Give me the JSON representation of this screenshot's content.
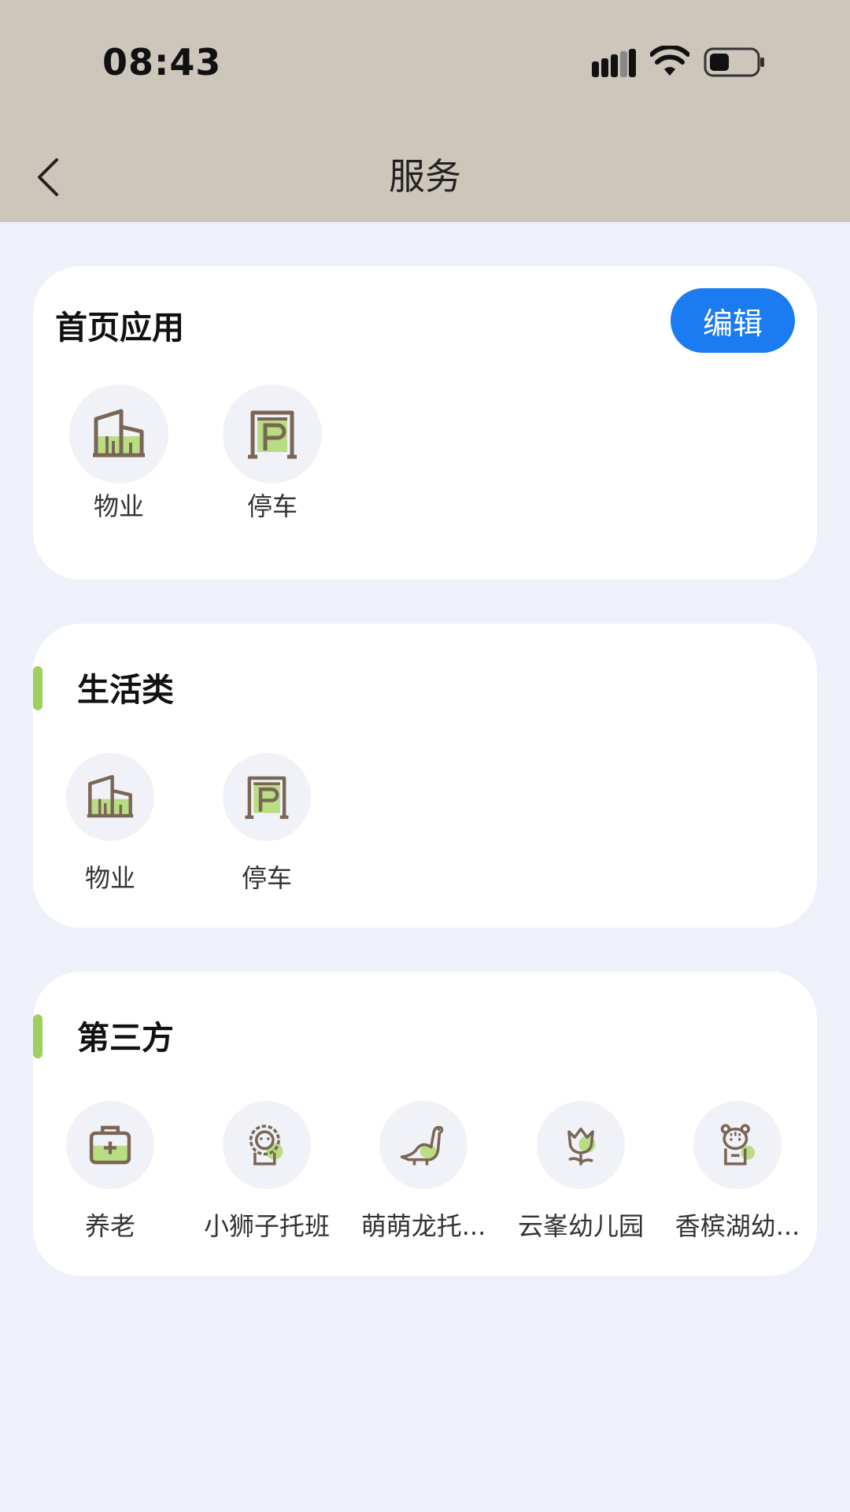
{
  "status_bar": {
    "time": "08:43"
  },
  "nav": {
    "title": "服务"
  },
  "home_apps": {
    "heading": "首页应用",
    "edit_label": "编辑",
    "items": [
      {
        "label": "物业",
        "icon": "building-icon"
      },
      {
        "label": "停车",
        "icon": "parking-icon"
      }
    ]
  },
  "life": {
    "heading": "生活类",
    "items": [
      {
        "label": "物业",
        "icon": "building-icon"
      },
      {
        "label": "停车",
        "icon": "parking-icon"
      }
    ]
  },
  "third_party": {
    "heading": "第三方",
    "items": [
      {
        "label": "养老",
        "icon": "first-aid-kit-icon"
      },
      {
        "label": "小狮子托班",
        "icon": "lion-icon"
      },
      {
        "label": "萌萌龙托...",
        "icon": "dinosaur-icon"
      },
      {
        "label": "云峯幼儿园",
        "icon": "tulip-icon"
      },
      {
        "label": "香槟湖幼...",
        "icon": "tiger-icon"
      }
    ]
  },
  "colors": {
    "header_bg": "#cdc6bb",
    "page_bg": "#eef1fa",
    "accent_green": "#9fcf5c",
    "edit_blue": "#1b7bf0",
    "icon_brown": "#7a6656"
  }
}
